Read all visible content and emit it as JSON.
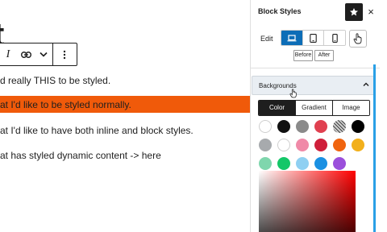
{
  "editor": {
    "title_fragment": "t",
    "toolbar": {
      "italic": "I",
      "link_icon": "link-icon",
      "more_icon": "chevron-down-icon",
      "options_icon": "more-vertical-icon"
    },
    "paragraphs": [
      "d really THIS to be styled.",
      "at I'd like to be styled normally.",
      "at I'd like to have both inline and block styles.",
      "at has styled dynamic content -> here"
    ],
    "highlight_color": "#f05a0a"
  },
  "sidebar": {
    "title": "Block Styles",
    "star_icon": "star-icon",
    "close_label": "×",
    "edit_label": "Edit",
    "devices": [
      {
        "name": "desktop-icon",
        "active": true
      },
      {
        "name": "tablet-icon",
        "active": false
      },
      {
        "name": "mobile-icon",
        "active": false
      }
    ],
    "picker_icon": "hand-pointer-icon",
    "before_label": "Before",
    "after_label": "After",
    "accordion": {
      "title": "Backgrounds",
      "expanded": true
    },
    "tabs": [
      {
        "label": "Color",
        "active": true
      },
      {
        "label": "Gradient",
        "active": false
      },
      {
        "label": "Image",
        "active": false
      }
    ],
    "swatches": [
      [
        "#ffffff",
        "#111111",
        "#8a8a8a",
        "#e04050",
        "checker",
        "#000000"
      ],
      [
        "#a7aaad",
        "#ffffff",
        "#f08aa8",
        "#cf1f3a",
        "#f0640f",
        "#f2b01c"
      ],
      [
        "#7fd6ad",
        "#14c768",
        "#8fd0f2",
        "#1a90e2",
        "#9b4fdb"
      ]
    ],
    "accent_color": "#0c6db7"
  }
}
